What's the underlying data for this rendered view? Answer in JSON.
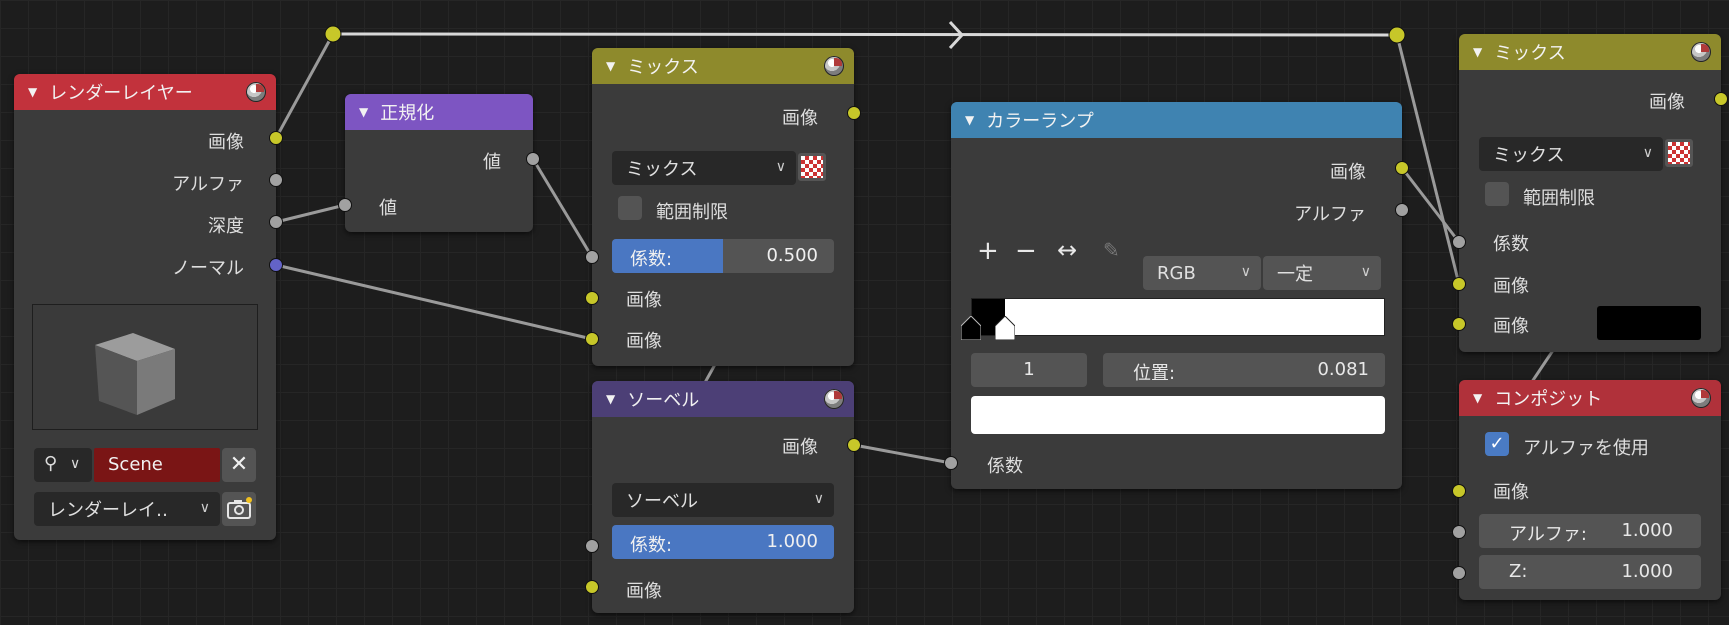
{
  "colors": {
    "render_layers_header": "#c2323c",
    "normalize_header": "#7d55c2",
    "mix_header": "#8e8a2c",
    "sobel_header": "#4c3f76",
    "color_ramp_header": "#3f83b1",
    "composite_header": "#b0313a",
    "socket_color": "#c7c729",
    "socket_value": "#a1a1a1",
    "socket_vector": "#6363c7"
  },
  "nodes": {
    "render_layers": {
      "title": "レンダーレイヤー",
      "outputs": [
        "画像",
        "アルファ",
        "深度",
        "ノーマル"
      ],
      "scene": "Scene",
      "layer": "レンダーレイ‥"
    },
    "normalize": {
      "title": "正規化",
      "output": "値",
      "input": "値"
    },
    "mix1": {
      "title": "ミックス",
      "output": "画像",
      "blend_mode": "ミックス",
      "clamp_label": "範囲制限",
      "factor_label": "係数:",
      "factor_value": "0.500",
      "factor_fraction": 0.5,
      "inputs": [
        "画像",
        "画像"
      ]
    },
    "sobel": {
      "title": "ソーベル",
      "output": "画像",
      "filter_type": "ソーベル",
      "factor_label": "係数:",
      "factor_value": "1.000",
      "factor_fraction": 1.0,
      "input": "画像"
    },
    "color_ramp": {
      "title": "カラーランプ",
      "outputs": [
        "画像",
        "アルファ"
      ],
      "add_icon": "+",
      "remove_icon": "−",
      "flip_icon": "↔",
      "color_mode": "RGB",
      "interpolation": "一定",
      "active_stop": "1",
      "position_label": "位置:",
      "position_value": "0.081",
      "input": "係数"
    },
    "mix2": {
      "title": "ミックス",
      "output": "画像",
      "blend_mode": "ミックス",
      "clamp_label": "範囲制限",
      "inputs": [
        "係数",
        "画像",
        "画像"
      ]
    },
    "composite": {
      "title": "コンポジット",
      "use_alpha_label": "アルファを使用",
      "input": "画像",
      "alpha_label": "アルファ:",
      "alpha_value": "1.000",
      "z_label": "Z:",
      "z_value": "1.000"
    }
  }
}
